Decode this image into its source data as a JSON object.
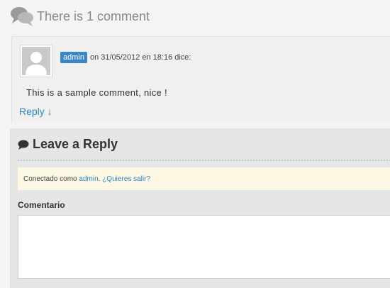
{
  "comments": {
    "title": "There is 1 comment",
    "title_icon": "comments-icon",
    "items": [
      {
        "author": "admin",
        "meta": "on 31/05/2012 en 18:16 dice:",
        "text": "This is a sample comment, nice !",
        "reply_label": "Reply ↓",
        "avatar_icon": "avatar-placeholder-icon"
      }
    ]
  },
  "reply_form": {
    "heading": "Leave a Reply",
    "heading_icon": "comment-bubble-icon",
    "logged_in_prefix": "Conectado como",
    "logged_in_user": "admin",
    "logout_link": "¿Quieres salir?",
    "comment_label": "Comentario",
    "comment_value": ""
  },
  "colors": {
    "author_badge": "#3b86c4",
    "link": "#2b87c0",
    "notice_background": "#fcf8e4",
    "title_gray": "#888888"
  }
}
